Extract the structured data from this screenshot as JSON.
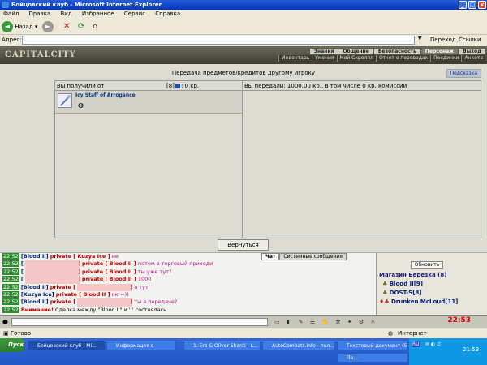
{
  "window": {
    "title": "Бойцовский клуб - Microsoft Internet Explorer"
  },
  "menu": [
    "Файл",
    "Правка",
    "Вид",
    "Избранное",
    "Сервис",
    "Справка"
  ],
  "toolbar": {
    "back": "Назад"
  },
  "address": {
    "label": "Адрес:",
    "go": "Переход",
    "links": "Ссылки"
  },
  "site": {
    "logo": "CAPITALCITY",
    "topnav": [
      "Знания",
      "Общение",
      "Безопасность",
      "Персонаж",
      "Выход"
    ],
    "subnav": [
      "Инвентарь",
      "Умения",
      "Мой Скроллл",
      "Отчет о переводах",
      "Поединки",
      "Анкета"
    ]
  },
  "transfer": {
    "title": "Передача предметов/кредитов другому игроку",
    "hint": "Подсказка",
    "received_label": "Вы получили от",
    "received_level": "[8]",
    "received_info": ": 0 кр.",
    "gave_label": "Вы передали: 1000.00 кр., в том числе 0 кр. комиссии",
    "item_name": "Icy Staff of Arrogance",
    "return_button": "Вернуться"
  },
  "chat": {
    "tab_chat": "Чат",
    "tab_system": "Системные сообщения",
    "lines": [
      {
        "time": "22:52",
        "pre": "[Blood II]",
        "p": "private [ Kuzya Ice ]",
        "msg": "не"
      },
      {
        "time": "22:52",
        "pre": "[",
        "box": true,
        "p": "private [ Blood II ]",
        "msg": "потом в торговый приходи"
      },
      {
        "time": "22:52",
        "pre": "[",
        "box": true,
        "p": "private [ Blood II ]",
        "msg": "ты уже тут?"
      },
      {
        "time": "22:52",
        "pre": "[",
        "box": true,
        "p": "private [ Blood II ]",
        "msg": "1000"
      },
      {
        "time": "22:52",
        "pre": "[Blood II]",
        "p": "private [",
        "box2": true,
        "msg": "я тут"
      },
      {
        "time": "22:52",
        "pre": "[Kuzya Ice]",
        "p": "private [ Blood II ]",
        "msg": "ок!=))"
      },
      {
        "time": "22:52",
        "pre": "[Blood II]",
        "p": "private [",
        "box2": true,
        "msg": "ты в передаче?"
      },
      {
        "time": "22:52",
        "pre": "",
        "warn": "Внимание!",
        "msg": "Сделка между \"Blood II\" и '        ' состоялась"
      }
    ]
  },
  "users": {
    "refresh": "Обновить",
    "shop": "Магазин Березка (8)",
    "list": [
      "Blood II[9]",
      "DOST-S[8]",
      "Drunken McLoud[11]"
    ]
  },
  "clock": "22:53",
  "status": {
    "left": "Готово",
    "right": "Интернет"
  },
  "taskbar": {
    "start": "Пуск",
    "tasks": [
      "Бойцовский клуб - Mi...",
      "Информация о",
      "1. Era & Oliver Shanti - L...",
      "AutoCombats.info - пол...",
      "Текстовый документ (5...",
      "Пе..."
    ],
    "time": "21:53",
    "lang": "RU"
  }
}
